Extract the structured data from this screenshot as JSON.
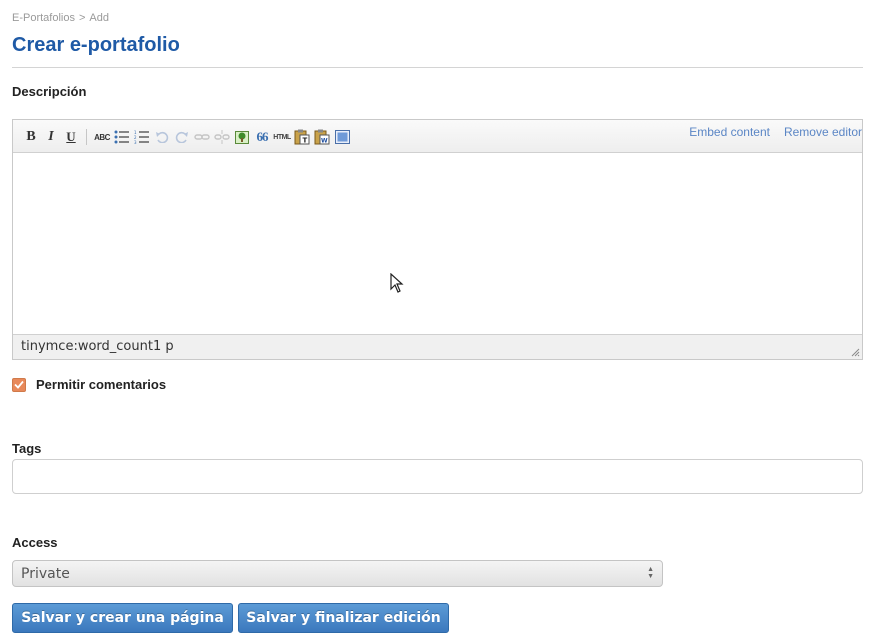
{
  "breadcrumb": {
    "parent": "E-Portafolios",
    "separator": ">",
    "current": "Add"
  },
  "page_title": "Crear e-portafolio",
  "description": {
    "label": "Descripción",
    "editor": {
      "toolbar": {
        "bold": "B",
        "italic": "I",
        "underline": "U",
        "spellcheck": "ABC",
        "blockquote": "66",
        "html": "HTML"
      },
      "embed_link": "Embed content",
      "remove_link": "Remove editor",
      "status": "tinymce:word_count1 p"
    }
  },
  "comments": {
    "label": "Permitir comentarios",
    "checked": true
  },
  "tags": {
    "label": "Tags",
    "value": ""
  },
  "access": {
    "label": "Access",
    "selected": "Private"
  },
  "buttons": {
    "create_page": "Salvar y crear una página",
    "finish": "Salvar y finalizar edición"
  },
  "colors": {
    "title": "#1f5aa6",
    "link": "#5b86c5",
    "button": "#3b78bd",
    "checkbox": "#e8895a"
  }
}
